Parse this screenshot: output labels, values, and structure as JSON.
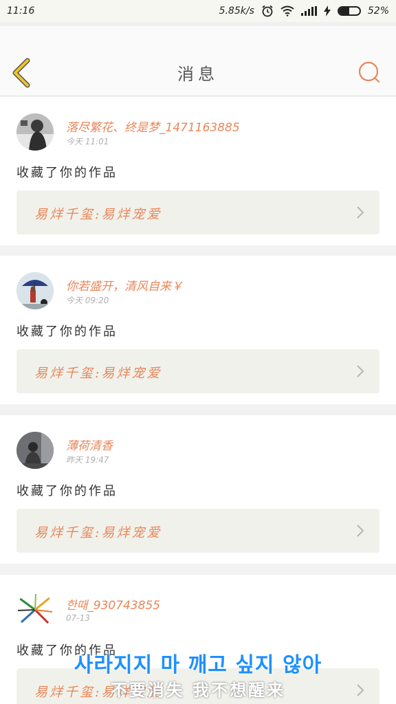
{
  "status_bar": {
    "time": "11:16",
    "speed": "5.85k/s",
    "battery": "52%",
    "battery_level": 0.52,
    "icons": [
      "alarm-icon",
      "wifi-icon",
      "signal-icon",
      "charging-icon",
      "battery-icon"
    ]
  },
  "header": {
    "title": "消息",
    "back_icon": "chevron-left-icon",
    "search_icon": "search-icon",
    "accent_color": "#e8875a",
    "back_color": "#f0c52a"
  },
  "messages": [
    {
      "user": "落尽繁花、终是梦_1471163885",
      "time": "今天 11:01",
      "action": "收藏了你的作品",
      "work": "易烊千玺:易烊宠爱"
    },
    {
      "user": "你若盛开，清风自来￥",
      "time": "今天 09:20",
      "action": "收藏了你的作品",
      "work": "易烊千玺:易烊宠爱"
    },
    {
      "user": "薄荷清香",
      "time": "昨天 19:47",
      "action": "收藏了你的作品",
      "work": "易烊千玺:易烊宠爱"
    },
    {
      "user": "한때_930743855",
      "time": "07-13",
      "action": "收藏了你的作品",
      "work": "易烊千玺:易烊宠爱"
    }
  ],
  "subtitle": {
    "korean": "사라지지 마 깨고 싶지 않아",
    "chinese": "不要消失 我不想醒来"
  }
}
